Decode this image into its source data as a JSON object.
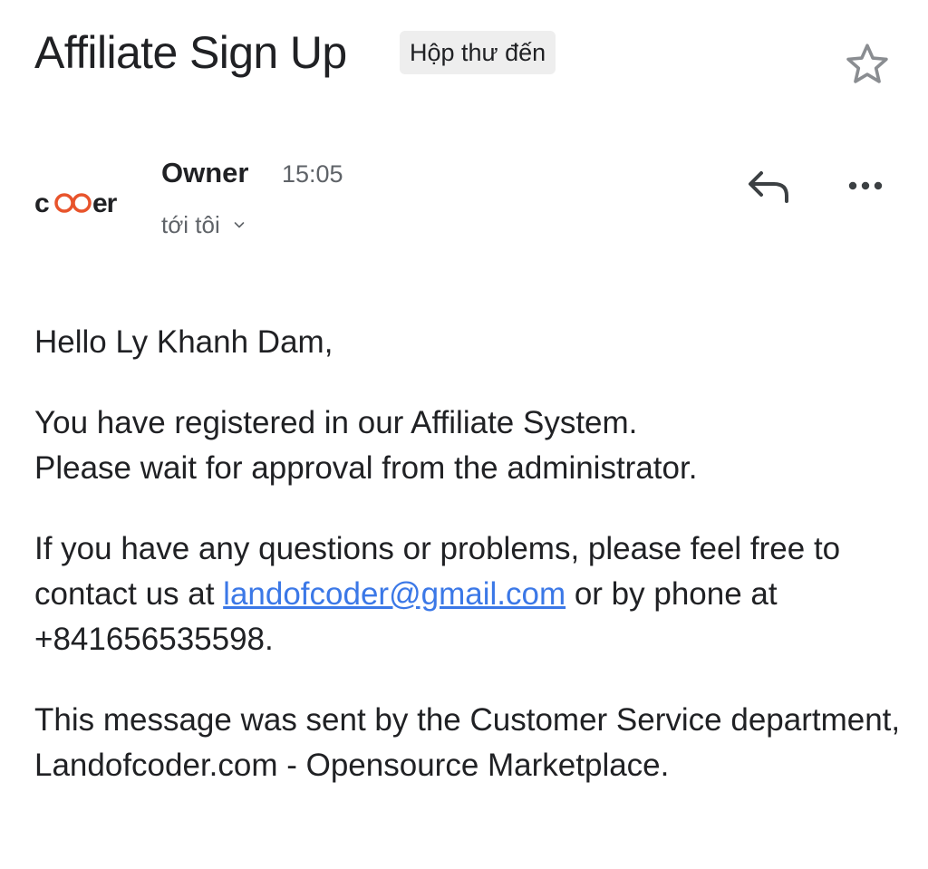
{
  "email": {
    "subject": "Affiliate Sign Up",
    "label": "Hộp thư đến",
    "sender": "Owner",
    "time": "15:05",
    "recipient": "tới tôi"
  },
  "avatar": {
    "logo_text": "coder",
    "colors": {
      "text": "#202124",
      "accent": "#e8542c"
    }
  },
  "icons": {
    "star": "star-outline-icon",
    "reply": "reply-icon",
    "more": "more-horizontal-icon",
    "chevron": "chevron-down-icon"
  },
  "body": {
    "greeting": "Hello Ly Khanh Dam,",
    "p1_line1": "You have registered in our Affiliate System.",
    "p1_line2": "Please wait for approval from the administrator.",
    "p2_before": "If you have any questions or problems, please feel free to contact us at ",
    "p2_link": "landofcoder@gmail.com",
    "p2_after": " or by phone at +841656535598.",
    "p3": "This message was sent by the Customer Service department, Landofcoder.com - Opensource Marketplace."
  },
  "colors": {
    "link": "#3b78e7",
    "secondary_text": "#5f6368",
    "chip_bg": "#eeeeee"
  }
}
